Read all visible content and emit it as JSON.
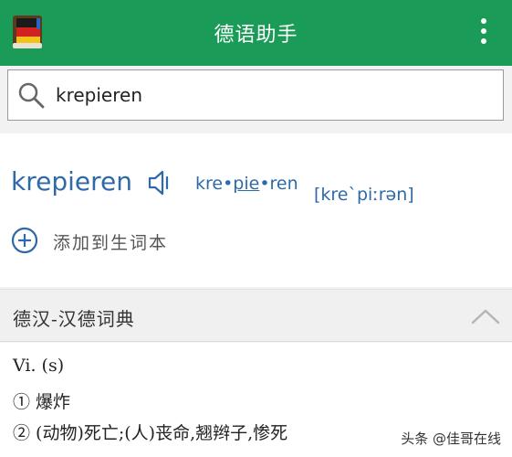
{
  "app": {
    "title": "德语助手"
  },
  "search": {
    "value": "krepieren"
  },
  "entry": {
    "headword": "krepieren",
    "syllables": {
      "before": "kre•",
      "stressed": "pie",
      "after": "•ren"
    },
    "ipa": "[kre`piːrən]",
    "add_to_vocab": "添加到生词本"
  },
  "dictionary": {
    "title": "德汉-汉德词典",
    "lines": [
      "Vi. (s)",
      "① 爆炸",
      "② (动物)死亡;(人)丧命,翘辫子,惨死"
    ]
  },
  "watermark": "头条 @佳哥在线",
  "colors": {
    "appbar": "#1a9b58",
    "accent_blue": "#2e6aa8"
  },
  "icons": [
    "app-book-icon",
    "more-vert-icon",
    "search-icon",
    "speaker-icon",
    "add-circle-icon",
    "chevron-up-icon"
  ]
}
